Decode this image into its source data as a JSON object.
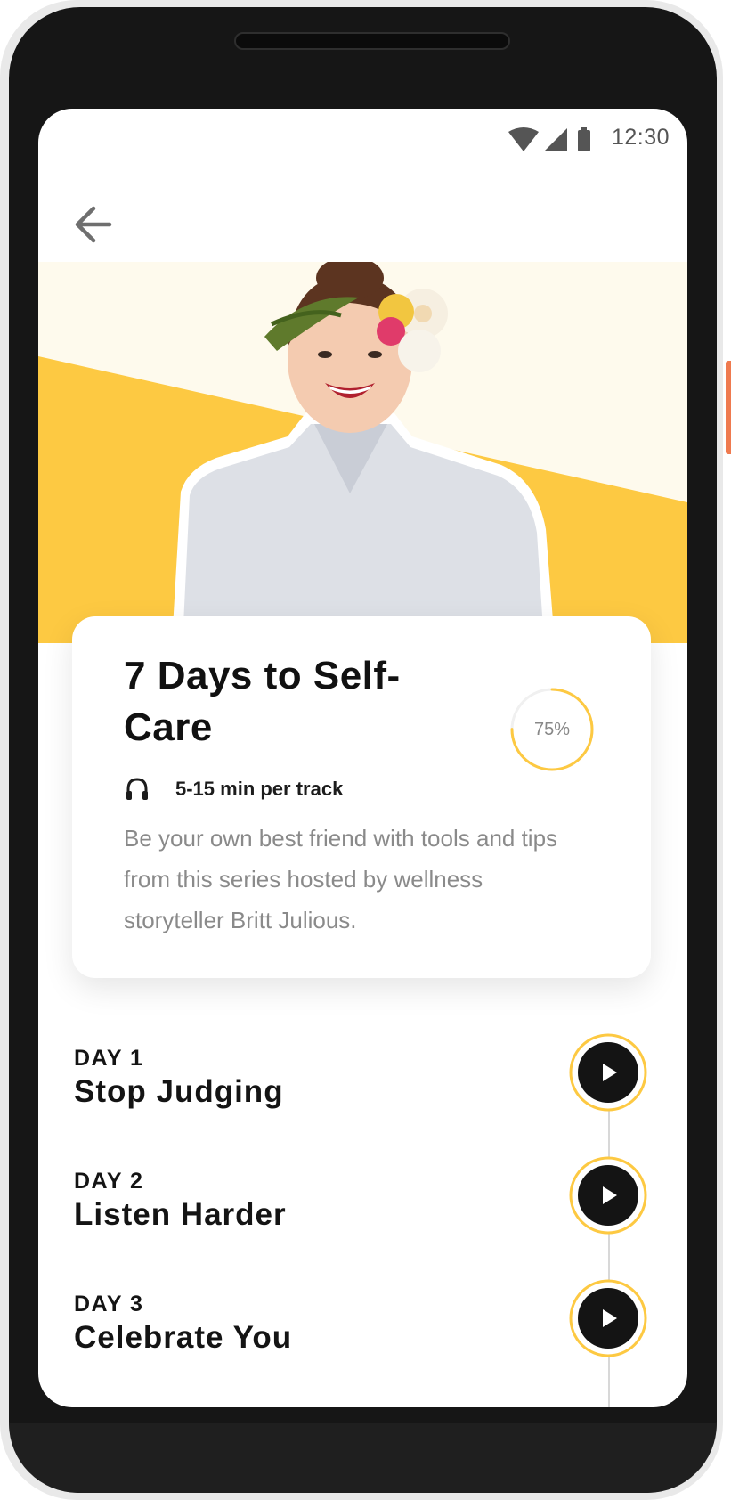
{
  "status_bar": {
    "time": "12:30",
    "icons": [
      "wifi-icon",
      "cellular-signal-icon",
      "battery-icon"
    ]
  },
  "header": {
    "back_icon": "arrow-left-icon"
  },
  "series": {
    "title": "7 Days to Self-Care",
    "progress_value": 0.75,
    "progress_label": "75%",
    "duration_icon": "headphones-icon",
    "duration": "5-15 min per track",
    "description": "Be your own best friend with tools and tips from this series hosted by wellness storyteller Britt Julious."
  },
  "tracks": [
    {
      "day": "DAY 1",
      "title": "Stop Judging"
    },
    {
      "day": "DAY 2",
      "title": "Listen Harder"
    },
    {
      "day": "DAY 3",
      "title": "Celebrate You"
    }
  ],
  "colors": {
    "accent_yellow": "#fdc942",
    "hero_background": "#fefaed",
    "play_button": "#141414",
    "text_dark": "#111111",
    "text_muted": "#8a8a8a"
  }
}
